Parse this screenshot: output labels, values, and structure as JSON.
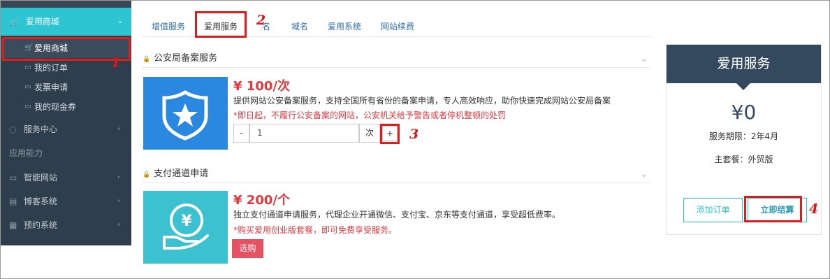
{
  "sidebar": {
    "header": "爱用商城",
    "sub_items": [
      {
        "label": "爱用商城",
        "icon": "cart-icon"
      },
      {
        "label": "我的订单",
        "icon": "order-icon"
      },
      {
        "label": "发票申请",
        "icon": "invoice-icon"
      },
      {
        "label": "我的现金券",
        "icon": "coupon-icon"
      }
    ],
    "service_center": "服务中心",
    "group_label": "应用能力",
    "items": [
      {
        "label": "智能网站",
        "icon": "monitor-icon"
      },
      {
        "label": "博客系统",
        "icon": "document-icon"
      },
      {
        "label": "预约系统",
        "icon": "calendar-icon"
      }
    ]
  },
  "tabs": [
    "增值服务",
    "爱用服务",
    "域名",
    "域名",
    "爱用系统",
    "网站续费"
  ],
  "tab_labels": {
    "t0": "增值服务",
    "t1": "爱用服务",
    "t2": "域名",
    "t3": "域名",
    "t4": "爱用系统",
    "t5": "网站续费"
  },
  "services": [
    {
      "title": "公安局备案服务",
      "price": "¥ 100/次",
      "description": "提供网站公安备案服务，支持全国所有省份的备案申请，专人高效响应，助你快速完成网站公安局备案",
      "notice": "*即日起，不履行公安备案的网站，公安机关给予警告或者停机整顿的处罚",
      "quantity": "1",
      "unit": "次",
      "minus": "-",
      "plus": "+"
    },
    {
      "title": "支付通道申请",
      "price": "¥ 200/个",
      "description": "独立支付通道申请服务，代理企业开通微信、支付宝、京东等支付通道，享受超低费率。",
      "notice": "*购买爱用创业版套餐，即可免费享受服务。",
      "buy": "选购"
    }
  ],
  "panel": {
    "title": "爱用服务",
    "amount": "¥0",
    "period": "服务期限：2年4月",
    "package": "主套餐：外贸版",
    "add_order": "添加订单",
    "checkout": "立即结算"
  },
  "annotations": [
    "1",
    "2",
    "3",
    "4"
  ],
  "colors": {
    "accent": "#2ec5d3",
    "sidebar": "#2f3e4c",
    "panel_head": "#34495e",
    "price": "#e2393f",
    "annotation": "#e11b1b"
  }
}
